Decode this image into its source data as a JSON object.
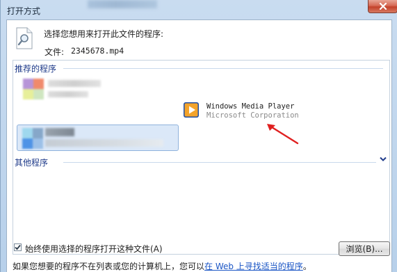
{
  "window": {
    "title": "打开方式"
  },
  "header": {
    "prompt": "选择您想用来打开此文件的程序:",
    "file_label": "文件:",
    "file_name": "2345678.mp4"
  },
  "recommended": {
    "heading": "推荐的程序",
    "programs": [
      {
        "name": "Windows Media Player",
        "company": "Microsoft Corporation",
        "icon": "windows-media-player-icon"
      }
    ]
  },
  "other": {
    "heading": "其他程序"
  },
  "options": {
    "always_use_label": "始终使用选择的程序打开这种文件(A)",
    "always_use_checked": true,
    "browse_label": "浏览(B)..."
  },
  "footer": {
    "text_before": "如果您想要的程序不在列表或您的计算机上，您可以",
    "link_text": "在 Web 上寻找适当的程序",
    "text_after": "。"
  },
  "colors": {
    "accent": "#1f3b8a",
    "link": "#1a55c5",
    "selection": "#dbe8f8",
    "arrow": "#e02020"
  }
}
